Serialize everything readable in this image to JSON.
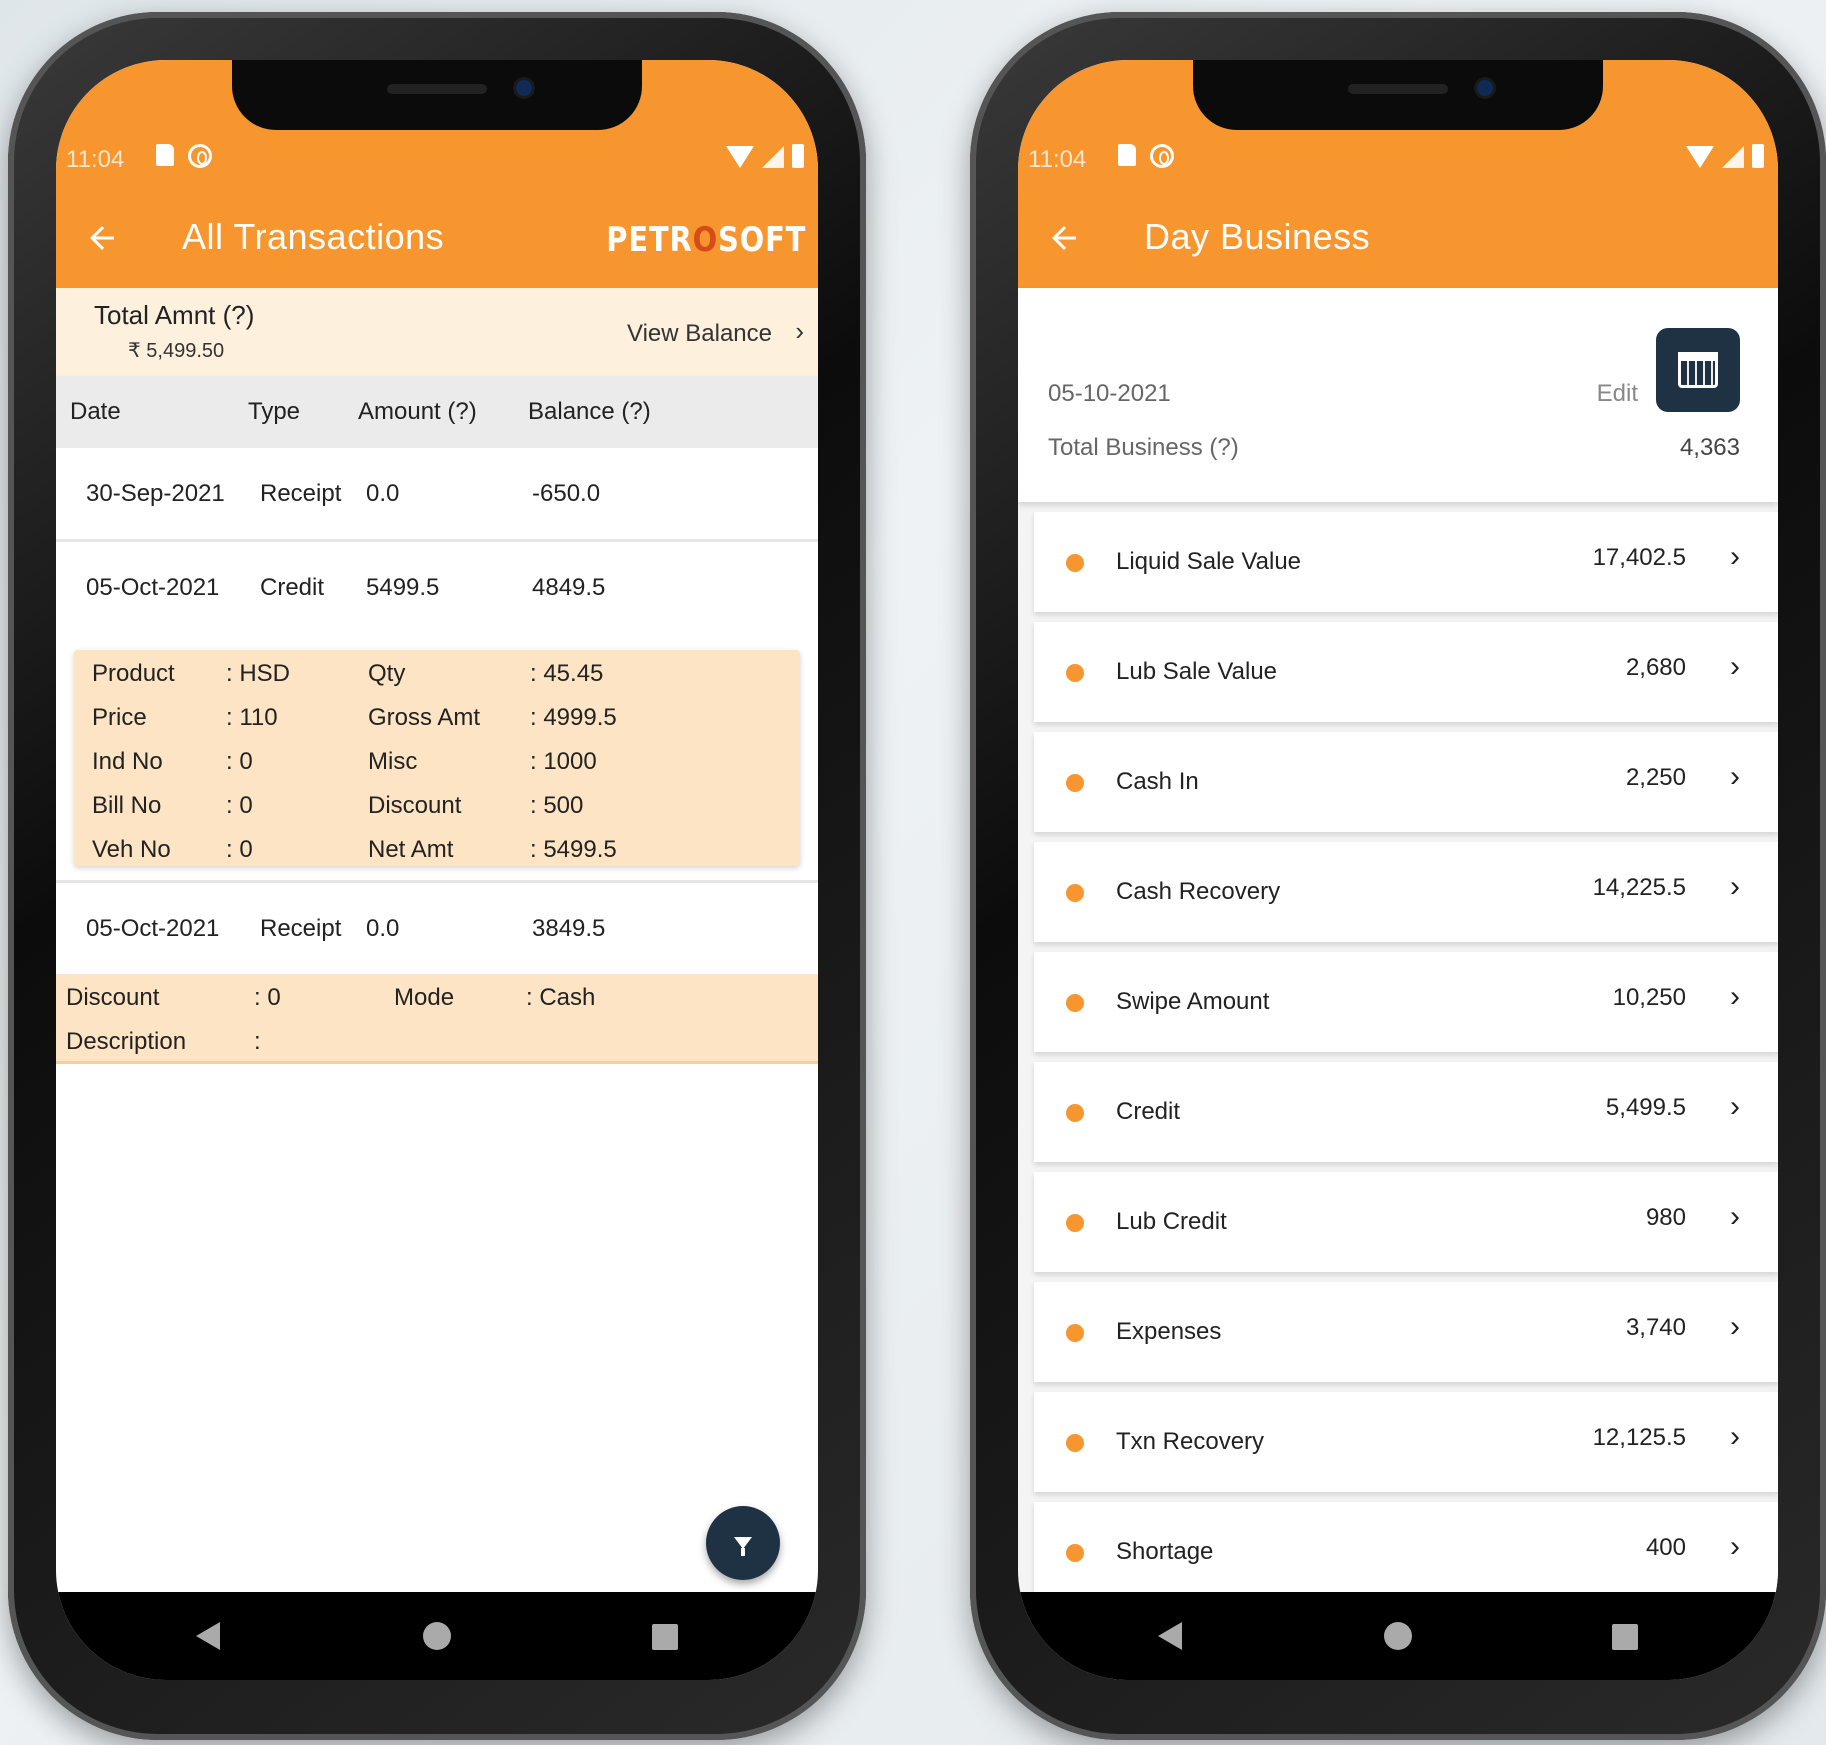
{
  "status": {
    "time": "11:04"
  },
  "left": {
    "title": "All Transactions",
    "brand": {
      "part1": "PETR",
      "mark": "O",
      "part2": "SOFT"
    },
    "total_label": "Total Amnt (?)",
    "total_value": "₹ 5,499.50",
    "view_balance": "View Balance",
    "columns": [
      "Date",
      "Type",
      "Amount (?)",
      "Balance (?)"
    ],
    "rows": [
      {
        "date": "30-Sep-2021",
        "type": "Receipt",
        "amount": "0.0",
        "balance": "-650.0"
      },
      {
        "date": "05-Oct-2021",
        "type": "Credit",
        "amount": "5499.5",
        "balance": "4849.5"
      },
      {
        "date": "05-Oct-2021",
        "type": "Receipt",
        "amount": "0.0",
        "balance": "3849.5"
      }
    ],
    "credit_detail": [
      {
        "k1": "Product",
        "v1": ": HSD",
        "k2": "Qty",
        "v2": ": 45.45"
      },
      {
        "k1": "Price",
        "v1": ": 110",
        "k2": "Gross Amt",
        "v2": ": 4999.5"
      },
      {
        "k1": "Ind No",
        "v1": ": 0",
        "k2": "Misc",
        "v2": ": 1000"
      },
      {
        "k1": "Bill No",
        "v1": ": 0",
        "k2": "Discount",
        "v2": ": 500"
      },
      {
        "k1": "Veh No",
        "v1": ": 0",
        "k2": "Net Amt",
        "v2": ": 5499.5"
      }
    ],
    "receipt_detail": {
      "discount_label": "Discount",
      "discount_value": ": 0",
      "mode_label": "Mode",
      "mode_value": ": Cash",
      "desc_label": "Description",
      "desc_value": ":"
    }
  },
  "right": {
    "title": "Day Business",
    "date": "05-10-2021",
    "edit": "Edit",
    "total_label": "Total Business (?)",
    "total_value": "4,363",
    "items": [
      {
        "label": "Liquid Sale Value",
        "value": "17,402.5"
      },
      {
        "label": "Lub Sale Value",
        "value": "2,680"
      },
      {
        "label": "Cash In",
        "value": "2,250"
      },
      {
        "label": "Cash Recovery",
        "value": "14,225.5"
      },
      {
        "label": "Swipe Amount",
        "value": "10,250"
      },
      {
        "label": "Credit",
        "value": "5,499.5"
      },
      {
        "label": "Lub Credit",
        "value": "980"
      },
      {
        "label": "Expenses",
        "value": "3,740"
      },
      {
        "label": "Txn Recovery",
        "value": "12,125.5"
      },
      {
        "label": "Shortage",
        "value": "400"
      }
    ]
  },
  "colors": {
    "accent": "#f7962f",
    "dark": "#1f3244",
    "detail_bg": "#fde4c4"
  }
}
